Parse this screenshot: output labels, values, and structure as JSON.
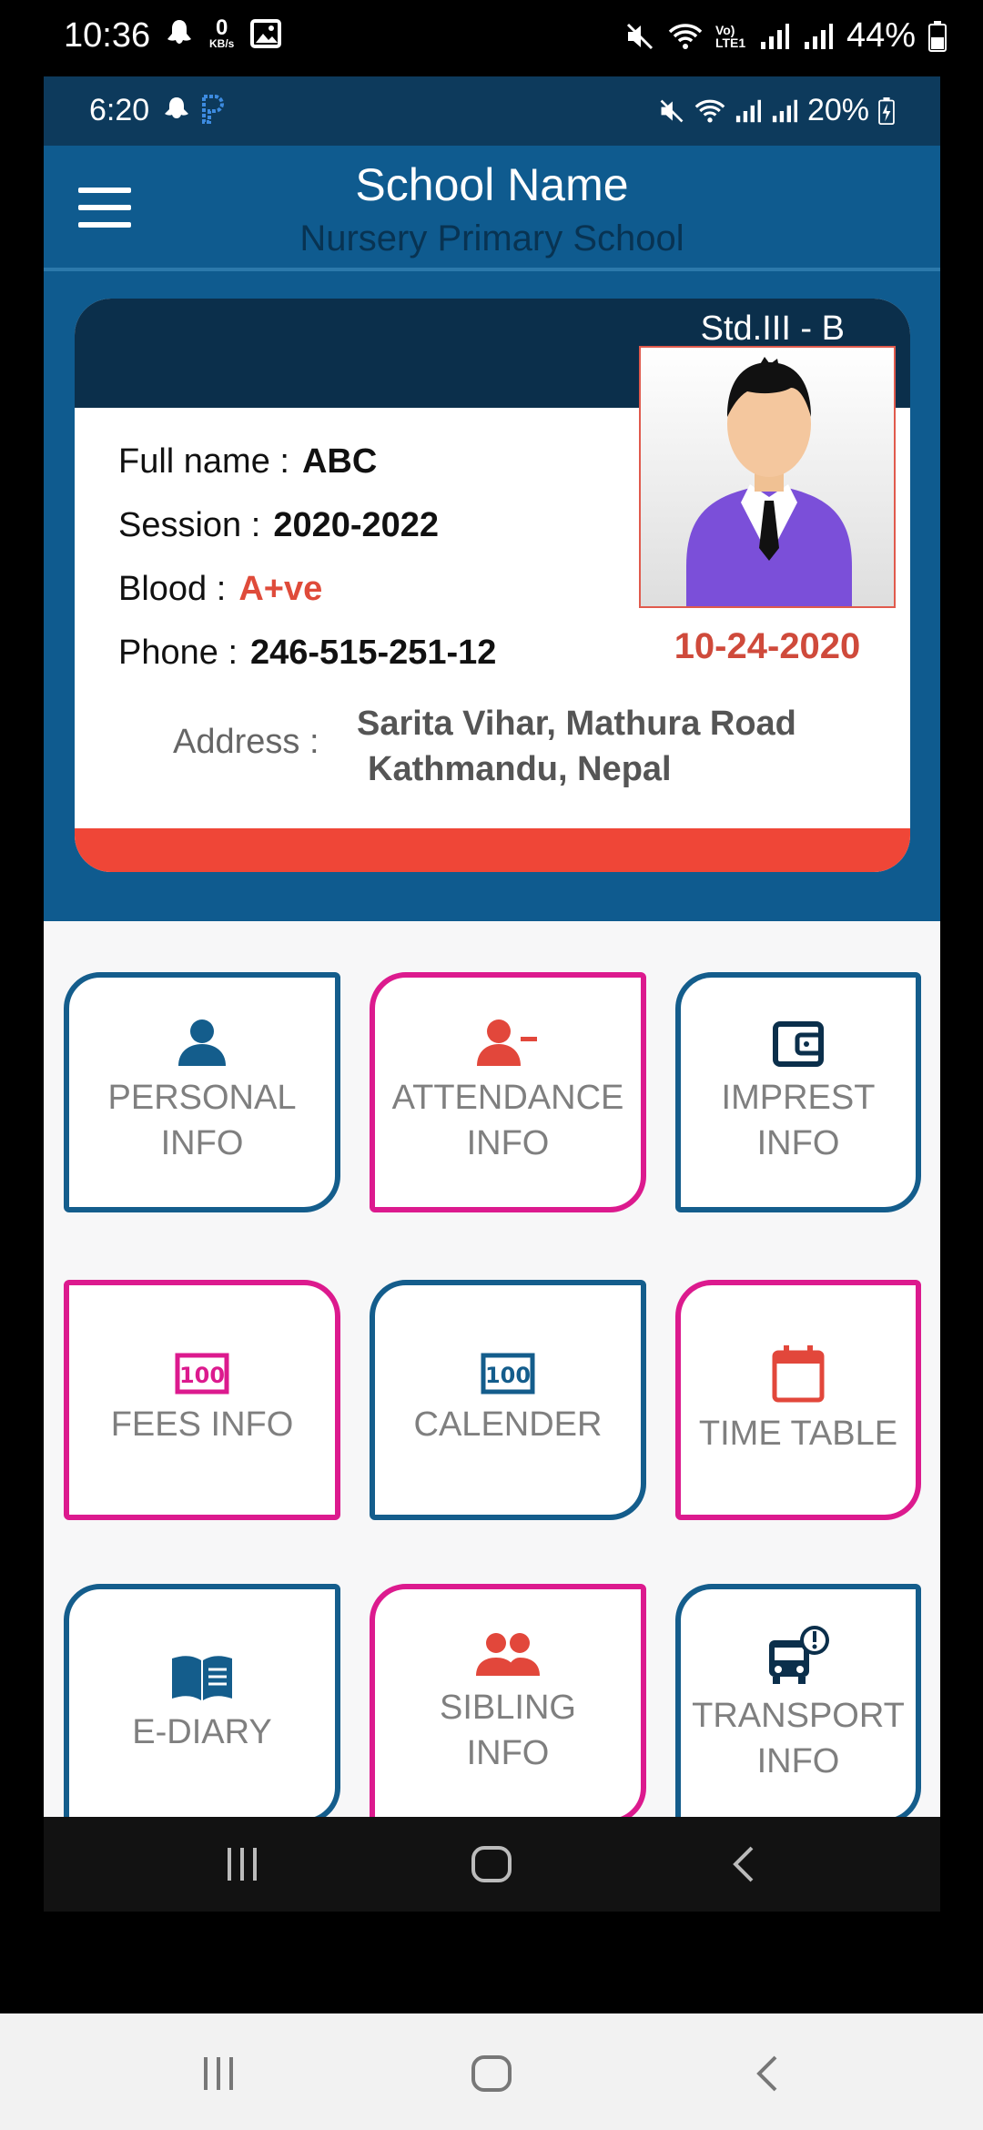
{
  "outer_status": {
    "time": "10:36",
    "kbs_value": "0",
    "kbs_unit": "KB/s",
    "battery": "44%",
    "net_label": "Vo) LTE1"
  },
  "inner_status": {
    "time": "6:20",
    "battery": "20%"
  },
  "appbar": {
    "title": "School Name",
    "subtitle": "Nursery Primary School"
  },
  "card": {
    "class": "Std.III - B",
    "full_name_label": "Full name :",
    "full_name": "ABC",
    "session_label": "Session :",
    "session": "2020-2022",
    "blood_label": "Blood :",
    "blood": "A+ve",
    "phone_label": "Phone :",
    "phone": "246-515-251-12",
    "address_label": "Address :",
    "address_line1": "Sarita Vihar, Mathura Road",
    "address_line2": "Kathmandu, Nepal",
    "photo_date": "10-24-2020"
  },
  "tiles": [
    {
      "label": "PERSONAL\nINFO",
      "icon": "person-icon",
      "color": "#145d8c"
    },
    {
      "label": "ATTENDANCE\nINFO",
      "icon": "person-minus-icon",
      "color": "#dc1a8e"
    },
    {
      "label": "IMPREST\nINFO",
      "icon": "wallet-icon",
      "color": "#145d8c"
    },
    {
      "label": "FEES INFO",
      "icon": "money-icon",
      "color": "#dc1a8e"
    },
    {
      "label": "CALENDER",
      "icon": "money-icon",
      "color": "#145d8c"
    },
    {
      "label": "TIME TABLE",
      "icon": "calendar-icon",
      "color": "#dc1a8e"
    },
    {
      "label": "E-DIARY",
      "icon": "book-icon",
      "color": "#145d8c"
    },
    {
      "label": "SIBLING\n     INFO",
      "icon": "users-icon",
      "color": "#dc1a8e"
    },
    {
      "label": "TRANSPORT\nINFO",
      "icon": "bus-alert-icon",
      "color": "#145d8c"
    }
  ],
  "colors": {
    "primary": "#0f5b8f",
    "dark": "#0b2f4b",
    "accent_red": "#ef4637",
    "pink": "#dc1a8e"
  }
}
